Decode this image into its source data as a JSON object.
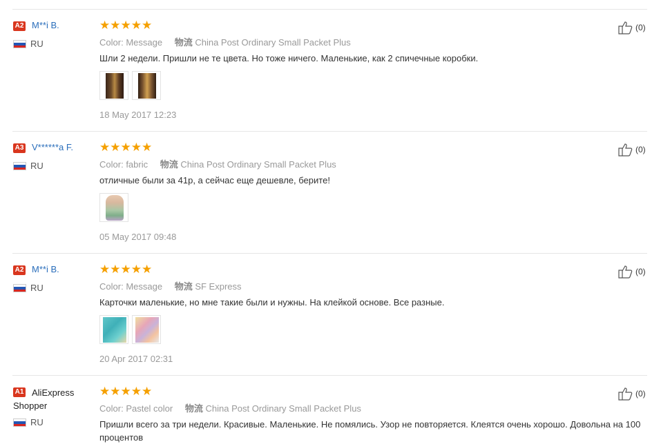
{
  "reviews": [
    {
      "badge": "A2",
      "user": "M**i B.",
      "country": "RU",
      "stars": "★★★★★",
      "color_label": "Color:",
      "color_value": "Message",
      "ship_label": "物流",
      "ship_value": "China Post Ordinary Small Packet Plus",
      "text": "Шли 2 недели. Пришли не те цвета. Но тоже ничего. Маленькие, как 2 спичечные коробки.",
      "date": "18 May 2017 12:23",
      "helpful": "(0)",
      "rating": 5,
      "photo_count": 2
    },
    {
      "badge": "A3",
      "user": "V******a F.",
      "country": "RU",
      "stars": "★★★★★",
      "color_label": "Color:",
      "color_value": "fabric",
      "ship_label": "物流",
      "ship_value": "China Post Ordinary Small Packet Plus",
      "text": "отличные были за 41р, а сейчас еще дешевле, берите!",
      "date": "05 May 2017 09:48",
      "helpful": "(0)",
      "rating": 5,
      "photo_count": 1
    },
    {
      "badge": "A2",
      "user": "M**i B.",
      "country": "RU",
      "stars": "★★★★★",
      "color_label": "Color:",
      "color_value": "Message",
      "ship_label": "物流",
      "ship_value": "SF Express",
      "text": "Карточки маленькие, но мне такие были и нужны. На клейкой основе. Все разные.",
      "date": "20 Apr 2017 02:31",
      "helpful": "(0)",
      "rating": 5,
      "photo_count": 2
    },
    {
      "badge": "A1",
      "user": "AliExpress Shopper",
      "country": "RU",
      "stars": "★★★★★",
      "color_label": "Color:",
      "color_value": "Pastel color",
      "ship_label": "物流",
      "ship_value": "China Post Ordinary Small Packet Plus",
      "text": "Пришли всего за три недели. Красивые. Маленькие. Не помялись. Узор не повторяется. Клеятся очень хорошо. Довольна на 100 процентов",
      "helpful": "(0)",
      "rating": 5,
      "photo_count": 0
    }
  ],
  "colors": {
    "star": "#f5a000",
    "badge": "#d9361e",
    "username": "#2a6ebb"
  },
  "icons": {
    "helpful": "thumbs-up-icon",
    "country": "russia-flag-icon"
  }
}
